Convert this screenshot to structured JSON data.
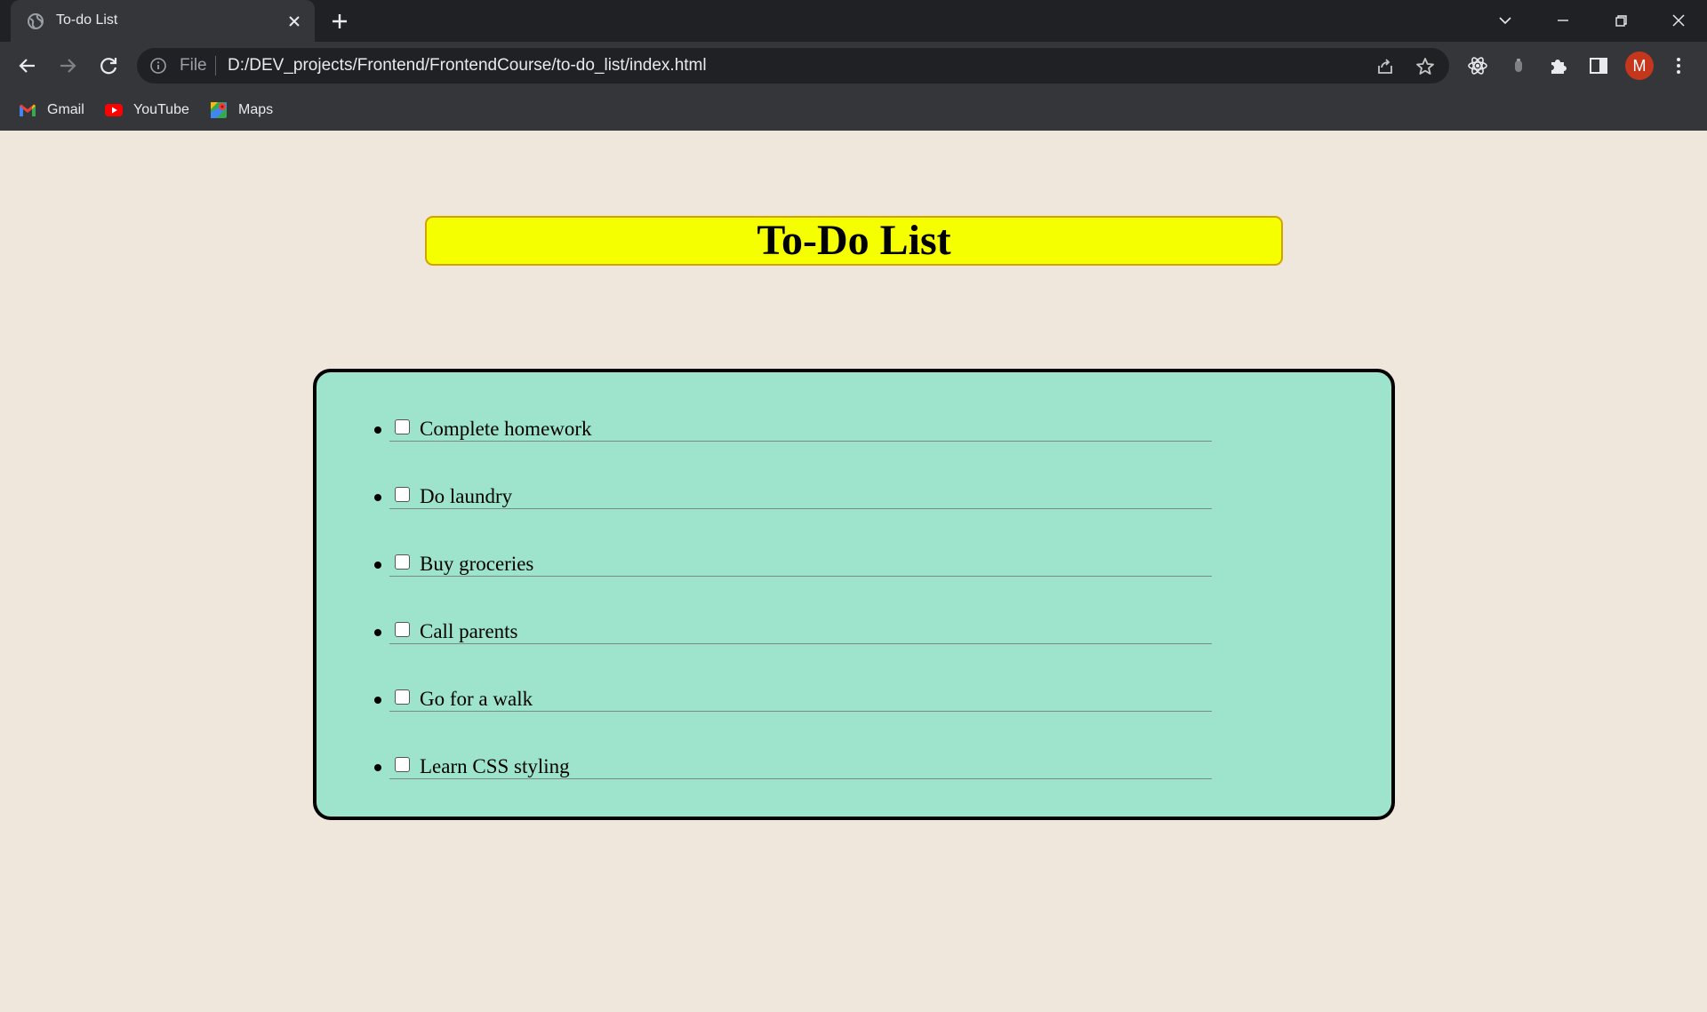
{
  "browser": {
    "tab_title": "To-do List",
    "omnibox": {
      "scheme_label": "File",
      "url": "D:/DEV_projects/Frontend/FrontendCourse/to-do_list/index.html"
    },
    "profile_initial": "M",
    "bookmarks": [
      {
        "label": "Gmail",
        "icon": "gmail-icon"
      },
      {
        "label": "YouTube",
        "icon": "youtube-icon"
      },
      {
        "label": "Maps",
        "icon": "maps-icon"
      }
    ]
  },
  "page": {
    "title": "To-Do List",
    "items": [
      {
        "label": "Complete homework",
        "checked": false
      },
      {
        "label": "Do laundry",
        "checked": false
      },
      {
        "label": "Buy groceries",
        "checked": false
      },
      {
        "label": "Call parents",
        "checked": false
      },
      {
        "label": "Go for a walk",
        "checked": false
      },
      {
        "label": "Learn CSS styling",
        "checked": false
      }
    ]
  },
  "colors": {
    "page_background": "#efe6dc",
    "heading_background": "#f6ff00",
    "heading_border": "#d0a300",
    "list_background": "#9ee4cc",
    "list_border": "#000000",
    "avatar": "#c5371d"
  }
}
